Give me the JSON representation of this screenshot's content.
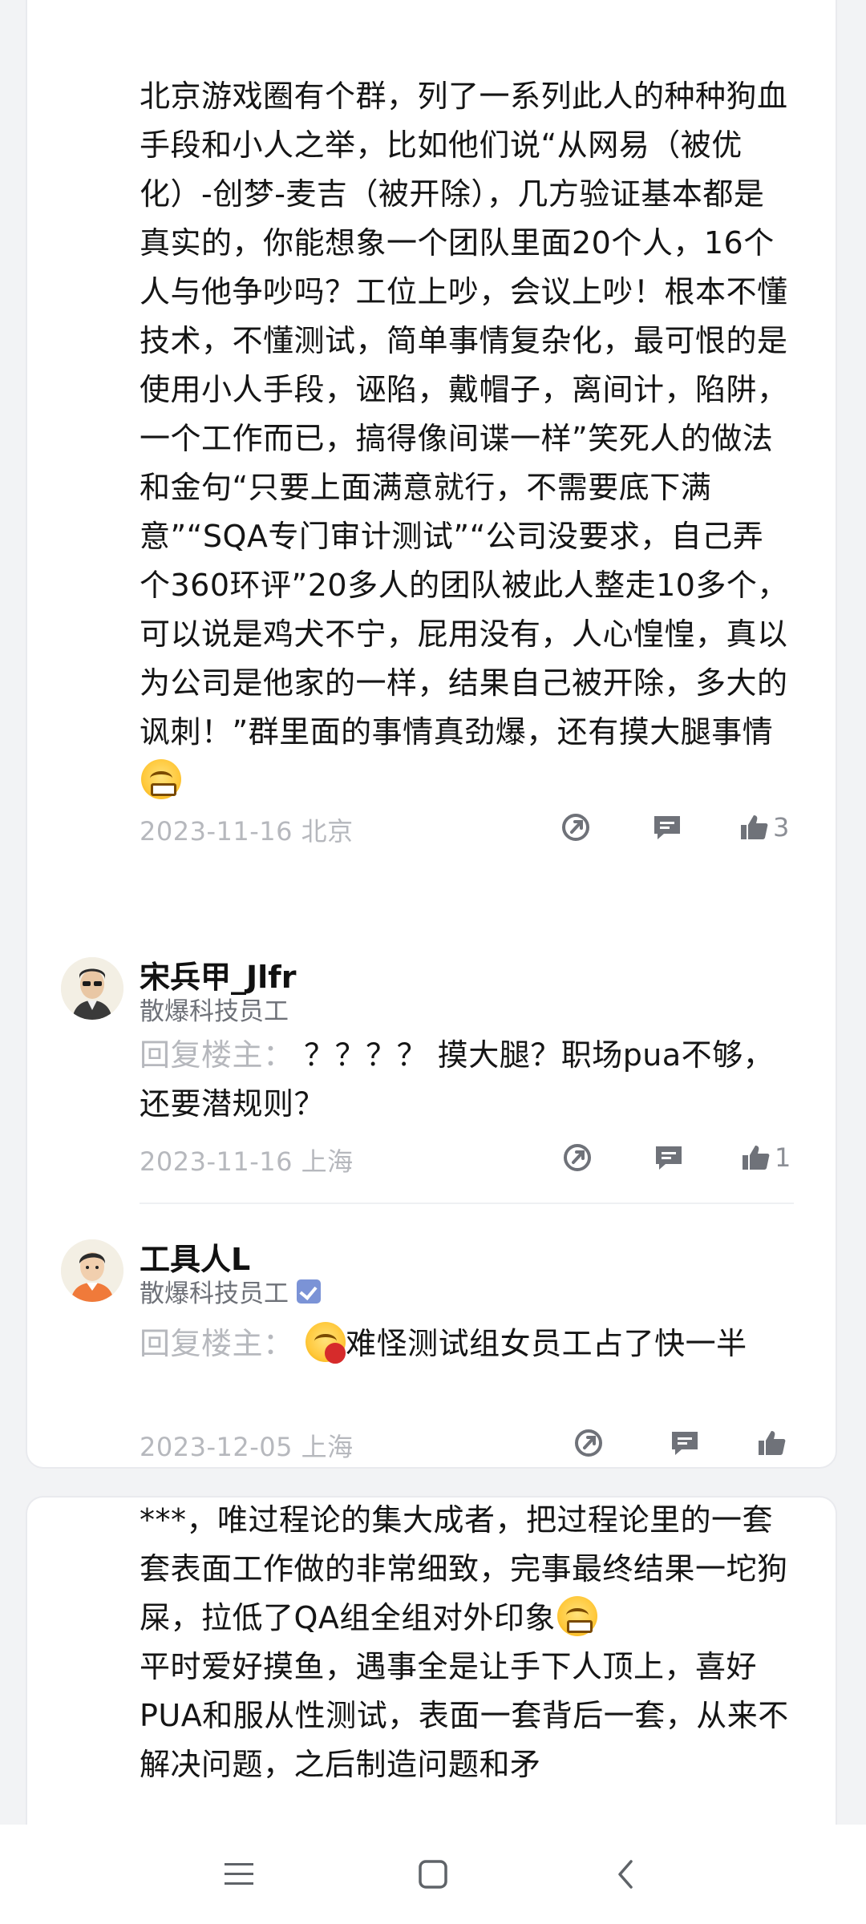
{
  "post1": {
    "text": "北京游戏圈有个群，列了一系列此人的种种狗血手段和小人之举，比如他们说“从网易（被优化）-创梦-麦吉（被开除），几方验证基本都是真实的，你能想象一个团队里面20个人，16个人与他争吵吗？工位上吵，会议上吵！根本不懂技术，不懂测试，简单事情复杂化，最可恨的是使用小人手段，诬陷，戴帽子，离间计，陷阱，一个工作而已，搞得像间谍一样”笑死人的做法和金句“只要上面满意就行，不需要底下满意”“SQA专门审计测试”“公司没要求，自己弄个360环评”20多人的团队被此人整走10多个，可以说是鸡犬不宁，屁用没有，人心惶惶，真以为公司是他家的一样，结果自己被开除，多大的讽刺！”群里面的事情真劲爆，还有摸大腿事情",
    "date": "2023-11-16",
    "location": "北京",
    "like_count": "3"
  },
  "replies": [
    {
      "username": "宋兵甲_Jlfr",
      "subtitle": "散爆科技员工",
      "prefix": "回复楼主：",
      "text": "？？？？ 摸大腿？职场pua不够，还要潜规则？",
      "date": "2023-11-16",
      "location": "上海",
      "like_count": "1"
    },
    {
      "username": "工具人L",
      "subtitle": "散爆科技员工",
      "prefix": "回复楼主：",
      "text": "难怪测试组女员工占了快一半",
      "date": "2023-12-05",
      "location": "上海",
      "like_count": ""
    }
  ],
  "post2": {
    "text_line1": "***，唯过程论的集大成者，把过程论里的一套套表面工作做的非常细致，完事最终结果一坨狗屎，拉低了QA组全组对外印象",
    "text_line2": "平时爱好摸鱼，遇事全是让手下人顶上，喜好PUA和服从性测试，表面一套背后一套，从来不解决问题，之后制造问题和矛"
  },
  "icons": {
    "share": "share-icon",
    "comment": "comment-icon",
    "like": "thumbs-up-icon",
    "nav_menu": "menu-icon",
    "nav_home": "home-icon",
    "nav_back": "back-icon"
  },
  "colors": {
    "icon_gray": "#6f7279",
    "meta_gray": "#b6b8bd",
    "badge_blue": "#7b93d6"
  }
}
